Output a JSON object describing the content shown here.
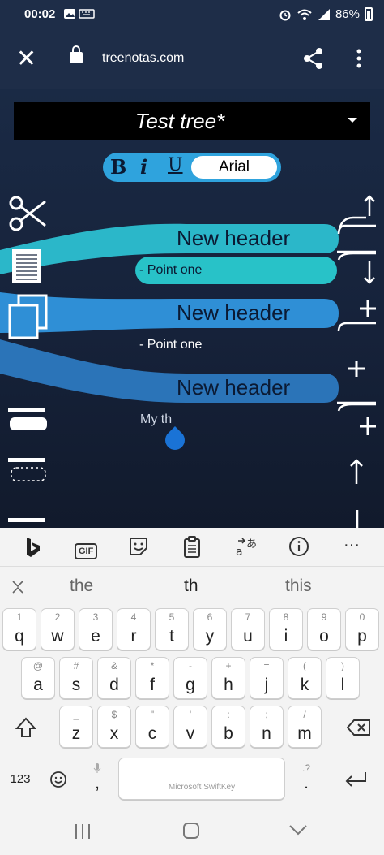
{
  "status": {
    "time": "00:02",
    "battery": "86%"
  },
  "browser": {
    "url": "treenotas.com"
  },
  "app": {
    "tree_title": "Test tree*",
    "format": {
      "bold": "B",
      "italic": "i",
      "underline": "U",
      "font": "Arial"
    },
    "nodes": [
      {
        "header": "New header",
        "point": "- Point one"
      },
      {
        "header": "New header",
        "point": "- Point one"
      },
      {
        "header": "New header",
        "point": "My th"
      }
    ],
    "colors": {
      "teal": "#28c2c8",
      "blue": "#2f8fd6",
      "steel": "#2b74b8"
    }
  },
  "keyboard": {
    "toolbar": [
      "bing-icon",
      "gif-icon",
      "sticker-icon",
      "clipboard-icon",
      "translate-icon",
      "info-icon",
      "more-icon"
    ],
    "gif_label": "GIF",
    "more_label": "···",
    "suggestions": [
      "the",
      "th",
      "this"
    ],
    "row1": [
      {
        "hint": "1",
        "key": "q"
      },
      {
        "hint": "2",
        "key": "w"
      },
      {
        "hint": "3",
        "key": "e"
      },
      {
        "hint": "4",
        "key": "r"
      },
      {
        "hint": "5",
        "key": "t"
      },
      {
        "hint": "6",
        "key": "y"
      },
      {
        "hint": "7",
        "key": "u"
      },
      {
        "hint": "8",
        "key": "i"
      },
      {
        "hint": "9",
        "key": "o"
      },
      {
        "hint": "0",
        "key": "p"
      }
    ],
    "row2": [
      {
        "hint": "@",
        "key": "a"
      },
      {
        "hint": "#",
        "key": "s"
      },
      {
        "hint": "&",
        "key": "d"
      },
      {
        "hint": "*",
        "key": "f"
      },
      {
        "hint": "-",
        "key": "g"
      },
      {
        "hint": "+",
        "key": "h"
      },
      {
        "hint": "=",
        "key": "j"
      },
      {
        "hint": "(",
        "key": "k"
      },
      {
        "hint": ")",
        "key": "l"
      }
    ],
    "row3": [
      {
        "hint": "_",
        "key": "z"
      },
      {
        "hint": "$",
        "key": "x"
      },
      {
        "hint": "\"",
        "key": "c"
      },
      {
        "hint": "'",
        "key": "v"
      },
      {
        "hint": ":",
        "key": "b"
      },
      {
        "hint": ";",
        "key": "n"
      },
      {
        "hint": "/",
        "key": "m"
      }
    ],
    "numbers_label": "123",
    "comma_label": ",",
    "period_label": ".",
    "period_hint": ".?",
    "space_label": "Microsoft SwiftKey"
  }
}
